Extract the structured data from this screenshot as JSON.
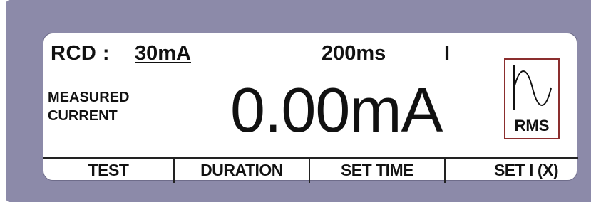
{
  "display": {
    "rcd_label": "RCD :",
    "rcd_current": "30mA",
    "duration": "200ms",
    "mode_indicator": "I",
    "measured_label_line1": "MEASURED",
    "measured_label_line2": "CURRENT",
    "reading": "0.00mA",
    "rms_label": "RMS",
    "rms_icon": "sine-wave-icon",
    "rms_box_color": "#8b2e2e"
  },
  "softkeys": [
    {
      "label": "TEST"
    },
    {
      "label": "DURATION"
    },
    {
      "label": "SET TIME"
    },
    {
      "label": "SET I (X)"
    }
  ],
  "colors": {
    "bezel": "#8c8aa9",
    "screen": "#ffffff",
    "text": "#111111"
  }
}
